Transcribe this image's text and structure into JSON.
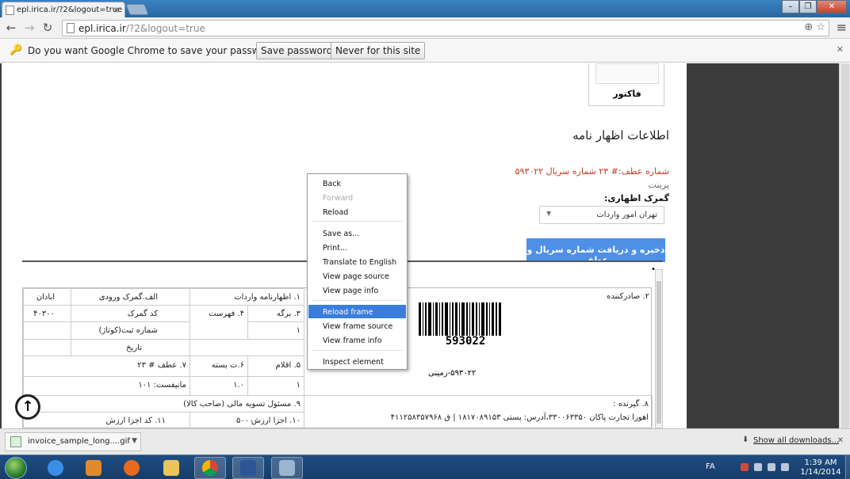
{
  "browser": {
    "tab_title": "epl.irica.ir/?2&logout=true",
    "url_host": "epl.irica.ir",
    "url_path": "/?2&logout=true"
  },
  "password_bar": {
    "message": "Do you want Google Chrome to save your password?",
    "save_label": "Save password",
    "never_label": "Never for this site"
  },
  "page": {
    "invoice_label": "فاکتور",
    "section_title": "اطلاعات اظهار نامه",
    "ref_line": "شماره عطف:# ۲۳ شماره سریال ۵۹۳۰۲۲",
    "status_line": "پرینت",
    "customs_label": "گمرک اظهاری:",
    "customs_value": "تهران امور واردات",
    "submit_button": "ذخیره و دریافت شماره سریال و عطف",
    "barcode_number": "593022",
    "serial_caption": "۵۹۳۰۲۲-زمینی"
  },
  "form": {
    "exporter_label": "۲. صادرکننده",
    "declaration_label": "۱. اظهارنامه واردات",
    "section_a": "الف.گمرک ورودی",
    "exchange_label": "ابادان",
    "page_label": "۳. برگه",
    "page_value": "۱",
    "list_label": "۴. فهرست",
    "customs_code_label": "کد گمرک",
    "customs_code_value": "۴۰۳۰۰",
    "reg_no_label": "شماره ثبت(کوتاژ)",
    "date_label": "تاریخ",
    "items_label": "۵. اقلام",
    "items_value": "۱",
    "packages_label": "۶.ت بسته",
    "packages_value": "۱.۰",
    "ref_label": "۷. عطف # ۲۳",
    "manifest_label": "مانیفست: ۱۰۱",
    "consignee_label": "۸. گیرنده :",
    "consignee_value": "اهورا تجارت پاکان ۳۳۰۰۶۳۳۵۰،آدرس: پستی ۱۸۱۷۰۸۹۱۵۳ | ق ۴۱۱۲۵۸۳۵۷۹۶۸",
    "finance_label": "۹. مسئول تسویه مالی (صاحب کالا)",
    "value_parts_label": "۱۰. اجزا ارزش",
    "value_parts_value": "۵۰۰۰۰",
    "value_code_label": "۱۱. کد اجزا ارزش"
  },
  "context_menu": {
    "items": [
      {
        "label": "Back",
        "enabled": true
      },
      {
        "label": "Forward",
        "enabled": false
      },
      {
        "label": "Reload",
        "enabled": true
      },
      {
        "label": "Save as...",
        "enabled": true
      },
      {
        "label": "Print...",
        "enabled": true
      },
      {
        "label": "Translate to English",
        "enabled": true
      },
      {
        "label": "View page source",
        "enabled": true
      },
      {
        "label": "View page info",
        "enabled": true
      },
      {
        "label": "Reload frame",
        "enabled": true,
        "highlighted": true
      },
      {
        "label": "View frame source",
        "enabled": true
      },
      {
        "label": "View frame info",
        "enabled": true
      },
      {
        "label": "Inspect element",
        "enabled": true
      }
    ]
  },
  "downloads": {
    "file_name": "invoice_sample_long....gif",
    "show_all": "Show all downloads..."
  },
  "taskbar": {
    "language": "FA",
    "time": "1:39 AM",
    "date": "1/14/2014"
  },
  "colors": {
    "accent_button": "#4d90e6",
    "ref_red": "#c0392b",
    "menu_highlight": "#3b7ddd",
    "taskbar": "#1f4c80"
  }
}
